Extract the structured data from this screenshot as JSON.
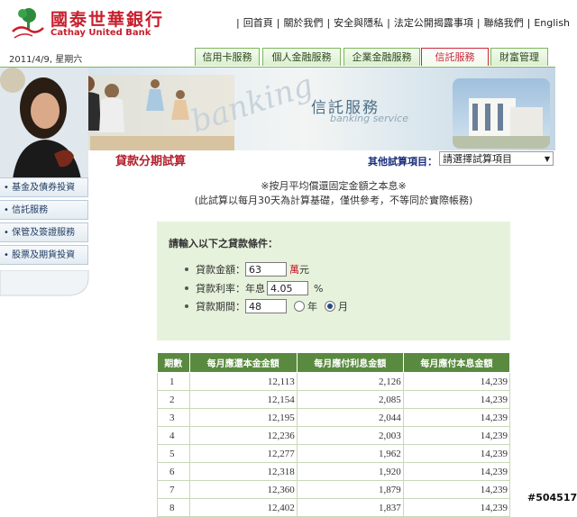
{
  "brand": {
    "name_zh": "國泰世華銀行",
    "name_en": "Cathay United Bank"
  },
  "topnav": [
    "回首頁",
    "關於我們",
    "安全與隱私",
    "法定公開揭露事項",
    "聯絡我們",
    "English"
  ],
  "date": "2011/4/9, 星期六",
  "tabs": [
    "信用卡服務",
    "個人金融服務",
    "企業金融服務",
    "信託服務",
    "財富管理"
  ],
  "active_tab": "信託服務",
  "banner": {
    "service_title": "信託服務",
    "service_sub": "banking service",
    "word": "banking"
  },
  "sidebar": [
    "基金及債券投資",
    "信託服務",
    "保管及簽證服務",
    "股票及期貨投資"
  ],
  "page_title": "貸款分期試算",
  "other_calc": {
    "label": "其他試算項目：",
    "selected": "請選擇試算項目"
  },
  "notes": [
    "※按月平均償還固定金額之本息※",
    "(此試算以每月30天為計算基礎，僅供參考，不等同於實際帳務)"
  ],
  "form": {
    "header": "請輸入以下之貸款條件：",
    "amount": {
      "label": "貸款金額：",
      "value": "63",
      "unit_red": "萬",
      "unit": "元"
    },
    "rate": {
      "label": "貸款利率：年息",
      "value": "4.05",
      "unit": "%"
    },
    "term": {
      "label": "貸款期間：",
      "value": "48",
      "opt_year": "年",
      "opt_month": "月",
      "selected": "月"
    }
  },
  "table": {
    "headers": [
      "期數",
      "每月應還本金金額",
      "每月應付利息金額",
      "每月應付本息金額"
    ],
    "rows": [
      [
        "1",
        "12,113",
        "2,126",
        "14,239"
      ],
      [
        "2",
        "12,154",
        "2,085",
        "14,239"
      ],
      [
        "3",
        "12,195",
        "2,044",
        "14,239"
      ],
      [
        "4",
        "12,236",
        "2,003",
        "14,239"
      ],
      [
        "5",
        "12,277",
        "1,962",
        "14,239"
      ],
      [
        "6",
        "12,318",
        "1,920",
        "14,239"
      ],
      [
        "7",
        "12,360",
        "1,879",
        "14,239"
      ],
      [
        "8",
        "12,402",
        "1,837",
        "14,239"
      ]
    ]
  },
  "watermark": "#504517"
}
